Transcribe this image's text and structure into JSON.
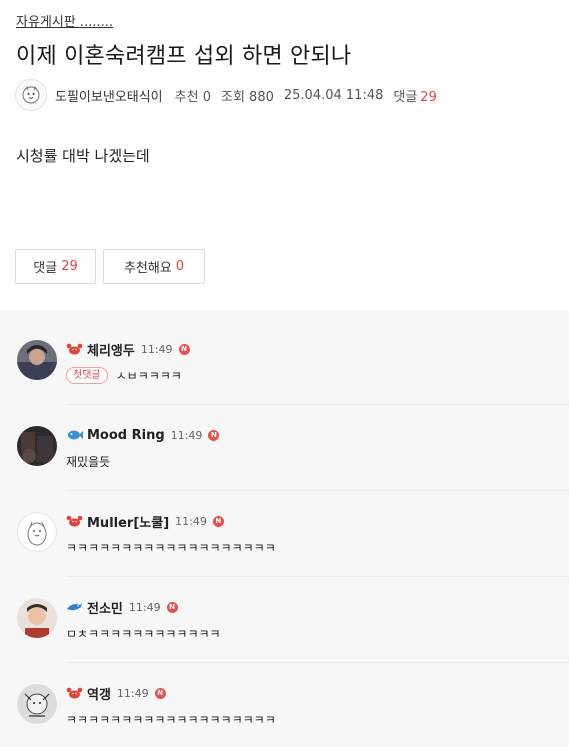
{
  "post": {
    "board": "자유게시판 ........",
    "title": "이제 이혼숙려캠프 섭외 하면 안되나",
    "author": "도필이보낸오태식이",
    "recommend_label": "추천",
    "recommend_count": "0",
    "views_label": "조회",
    "views_count": "880",
    "datetime": "25.04.04 11:48",
    "comments_label": "댓글",
    "comments_count": "29",
    "content": "시청률 대박 나겠는데"
  },
  "buttons": {
    "comments_label": "댓글",
    "comments_count": "29",
    "recommend_label": "추천해요",
    "recommend_count": "0"
  },
  "colors": {
    "accent": "#e2434b",
    "comment_bg": "#f7f7f7"
  },
  "comments": [
    {
      "nick": "체리앵두",
      "time": "11:49",
      "badge": "첫댓글",
      "text": "ㅅㅂㅋㅋㅋㅋ",
      "level_icon": "crab-icon"
    },
    {
      "nick": "Mood Ring",
      "time": "11:49",
      "text": "재밌을듯",
      "level_icon": "fish-icon"
    },
    {
      "nick": "Muller[노쿨]",
      "time": "11:49",
      "text": "ㅋㅋㅋㅋㅋㅋㅋㅋㅋㅋㅋㅋㅋㅋㅋㅋㅋㅋㅋ",
      "level_icon": "crab-icon"
    },
    {
      "nick": "전소민",
      "time": "11:49",
      "text": "ㅁㅊㅋㅋㅋㅋㅋㅋㅋㅋㅋㅋㅋㅋ",
      "level_icon": "dolphin-icon"
    },
    {
      "nick": "역갱",
      "time": "11:49",
      "text": "ㅋㅋㅋㅋㅋㅋㅋㅋㅋㅋㅋㅋㅋㅋㅋㅋㅋㅋㅋ",
      "level_icon": "crab-icon"
    }
  ],
  "n_badge_letter": "N"
}
